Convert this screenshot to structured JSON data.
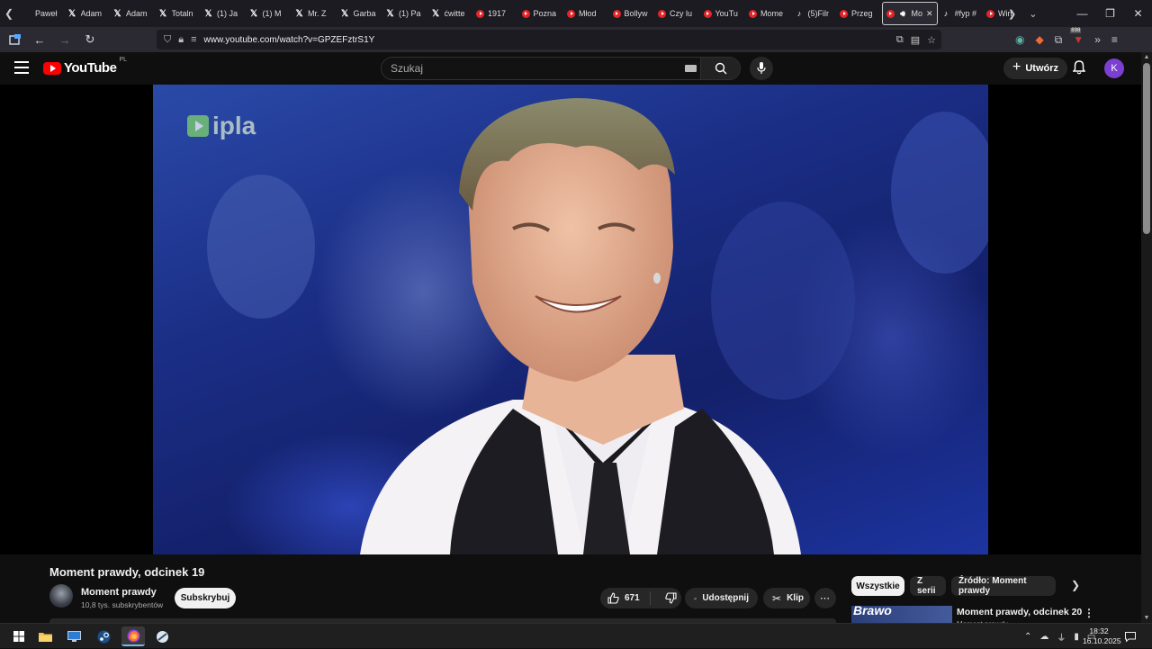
{
  "browser": {
    "tabs": [
      {
        "icon": "page-icon",
        "label": "Paweł"
      },
      {
        "icon": "x-icon",
        "label": "Adam"
      },
      {
        "icon": "x-icon",
        "label": "Adam"
      },
      {
        "icon": "x-icon",
        "label": "Totaln"
      },
      {
        "icon": "x-icon",
        "label": "(1) Ja"
      },
      {
        "icon": "x-icon",
        "label": "(1) M"
      },
      {
        "icon": "x-icon",
        "label": "Mr. Z"
      },
      {
        "icon": "x-icon",
        "label": "Garba"
      },
      {
        "icon": "x-icon",
        "label": "(1) Pa"
      },
      {
        "icon": "x-icon",
        "label": "ćwitte"
      },
      {
        "icon": "youtube-icon",
        "label": "1917"
      },
      {
        "icon": "youtube-icon",
        "label": "Pozna"
      },
      {
        "icon": "youtube-icon",
        "label": "Młod"
      },
      {
        "icon": "youtube-icon",
        "label": "Bollyw"
      },
      {
        "icon": "youtube-icon",
        "label": "Czy lu"
      },
      {
        "icon": "youtube-icon",
        "label": "YouTu"
      },
      {
        "icon": "youtube-icon",
        "label": "Mome"
      },
      {
        "icon": "tiktok-icon",
        "label": "(5)Filr"
      },
      {
        "icon": "youtube-icon",
        "label": "Przeg"
      },
      {
        "icon": "youtube-icon",
        "label": "Mo",
        "active": true
      },
      {
        "icon": "tiktok-icon",
        "label": "#fyp #"
      },
      {
        "icon": "youtube-icon",
        "label": "Win"
      }
    ],
    "url": "www.youtube.com/watch?v=GPZEFztrS1Y",
    "extension_badge": "898"
  },
  "youtube": {
    "logo_text": "YouTube",
    "country_code": "PL",
    "search_placeholder": "Szukaj",
    "create_label": "Utwórz",
    "avatar_letter": "K",
    "video_watermark": "ipla",
    "video": {
      "title": "Moment prawdy, odcinek 19",
      "channel_name": "Moment prawdy",
      "channel_subscribers": "10,8 tys. subskrybentów",
      "subscribe_label": "Subskrybuj",
      "likes": "671",
      "share_label": "Udostępnij",
      "clip_label": "Klip"
    },
    "chips": [
      "Wszystkie",
      "Z serii",
      "Źródło: Moment prawdy"
    ],
    "recommendation": {
      "title": "Moment prawdy, odcinek 20",
      "channel": "Moment prawdy",
      "thumbnail_text": "Brawo"
    }
  },
  "taskbar": {
    "apps": [
      "windows-start-icon",
      "file-explorer-icon",
      "remote-desktop-icon",
      "steam-icon",
      "firefox-icon",
      "other-app-icon"
    ],
    "time": "18:32",
    "date": "16.10.2025"
  },
  "colors": {
    "youtube_red": "#ff0000",
    "page_bg": "#0f0f0f",
    "avatar_purple": "#7b3fd1"
  }
}
